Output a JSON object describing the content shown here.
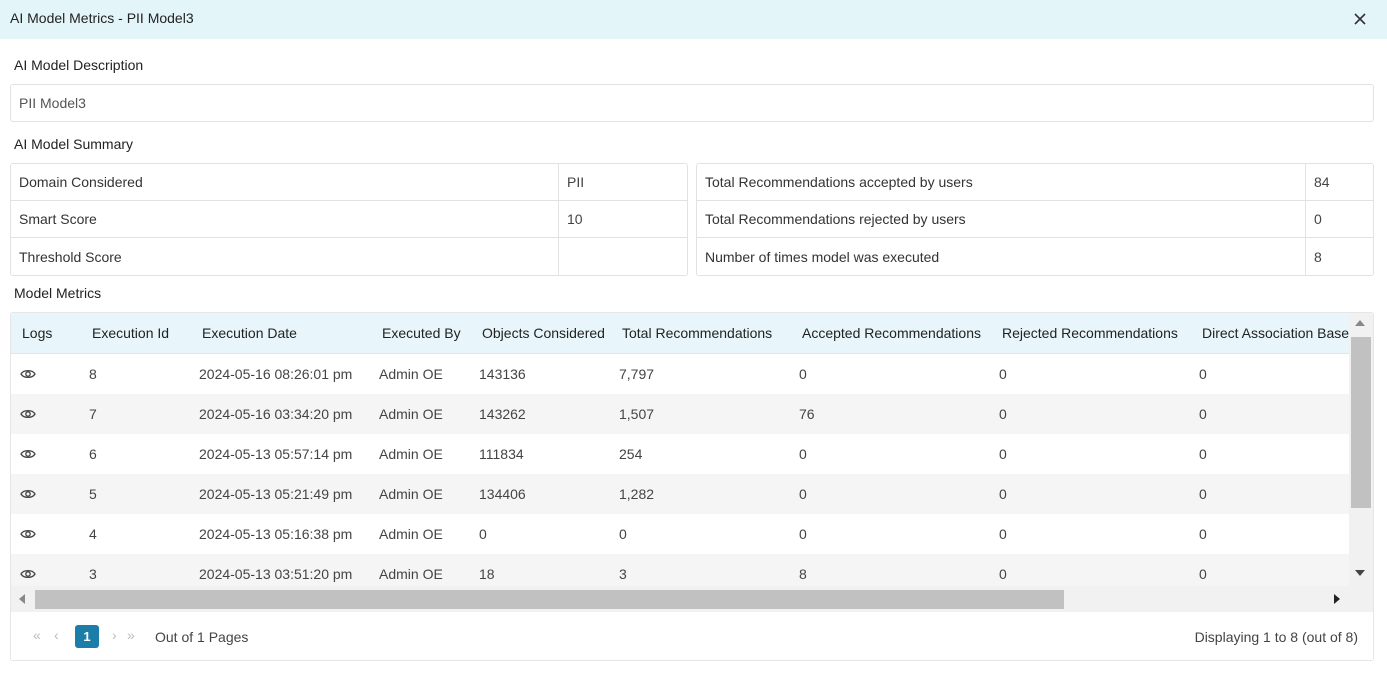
{
  "window": {
    "title": "AI Model Metrics - PII Model3"
  },
  "description": {
    "label": "AI Model Description",
    "value": "PII Model3"
  },
  "summary": {
    "label": "AI Model Summary",
    "left": [
      {
        "key": "Domain Considered",
        "value": "PII"
      },
      {
        "key": "Smart Score",
        "value": "10"
      },
      {
        "key": "Threshold Score",
        "value": ""
      }
    ],
    "right": [
      {
        "key": "Total Recommendations accepted by users",
        "value": "84"
      },
      {
        "key": "Total Recommendations rejected by users",
        "value": "0"
      },
      {
        "key": "Number of times model was executed",
        "value": "8"
      }
    ]
  },
  "metrics": {
    "label": "Model Metrics",
    "columns": [
      "Logs",
      "Execution Id",
      "Execution Date",
      "Executed By",
      "Objects Considered",
      "Total Recommendations",
      "Accepted Recommendations",
      "Rejected Recommendations",
      "Direct Association Base"
    ],
    "rows": [
      {
        "id": "8",
        "date": "2024-05-16 08:26:01 pm",
        "by": "Admin OE",
        "objects": "143136",
        "total": "7,797",
        "accepted": "0",
        "rejected": "0",
        "direct": "0"
      },
      {
        "id": "7",
        "date": "2024-05-16 03:34:20 pm",
        "by": "Admin OE",
        "objects": "143262",
        "total": "1,507",
        "accepted": "76",
        "rejected": "0",
        "direct": "0"
      },
      {
        "id": "6",
        "date": "2024-05-13 05:57:14 pm",
        "by": "Admin OE",
        "objects": "111834",
        "total": "254",
        "accepted": "0",
        "rejected": "0",
        "direct": "0"
      },
      {
        "id": "5",
        "date": "2024-05-13 05:21:49 pm",
        "by": "Admin OE",
        "objects": "134406",
        "total": "1,282",
        "accepted": "0",
        "rejected": "0",
        "direct": "0"
      },
      {
        "id": "4",
        "date": "2024-05-13 05:16:38 pm",
        "by": "Admin OE",
        "objects": "0",
        "total": "0",
        "accepted": "0",
        "rejected": "0",
        "direct": "0"
      },
      {
        "id": "3",
        "date": "2024-05-13 03:51:20 pm",
        "by": "Admin OE",
        "objects": "18",
        "total": "3",
        "accepted": "8",
        "rejected": "0",
        "direct": "0"
      }
    ]
  },
  "pager": {
    "current_page": "1",
    "out_of": "Out of 1 Pages",
    "displaying": "Displaying 1 to 8 (out of 8)",
    "first_icon": "«",
    "prev_icon": "‹",
    "next_icon": "›",
    "last_icon": "»"
  },
  "colors": {
    "accent": "#1a7ea8",
    "header_bg": "#e4f5fa",
    "grid_header_bg": "#e8f6fb"
  }
}
